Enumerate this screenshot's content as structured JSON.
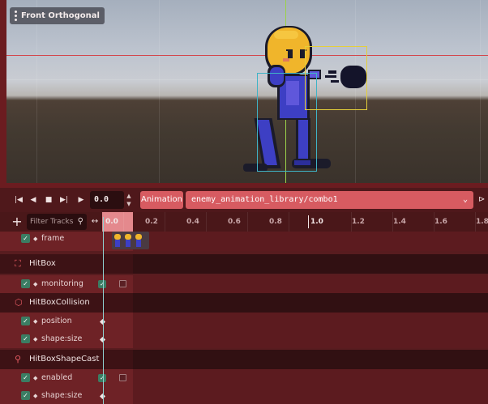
{
  "viewport": {
    "view_menu_label": "Front Orthogonal"
  },
  "toolbar": {
    "buttons": [
      "play-backwards-from-end",
      "play-backwards",
      "stop",
      "play",
      "play-from-start"
    ],
    "time_value": "0.0",
    "animation_button": "Animation",
    "animation_selected": "enemy_animation_library/combo1"
  },
  "timeline": {
    "filter_placeholder": "Filter Tracks",
    "ruler_labels": [
      "0.0",
      "0.2",
      "0.4",
      "0.6",
      "0.8",
      "1.0",
      "1.2",
      "1.4",
      "1.6",
      "1.8"
    ]
  },
  "tracks": {
    "frame": "frame",
    "hitbox": "HitBox",
    "monitoring": "monitoring",
    "hitbox_collision": "HitBoxCollision",
    "position": "position",
    "shape_size_1": "shape:size",
    "hitbox_shapecast": "HitBoxShapeCast",
    "enabled": "enabled",
    "shape_size_2": "shape:size"
  },
  "colors": {
    "accent": "#d75b61",
    "panel": "#581c1f",
    "checkbox": "#3b7d63",
    "playhead": "#8fd1d0"
  }
}
